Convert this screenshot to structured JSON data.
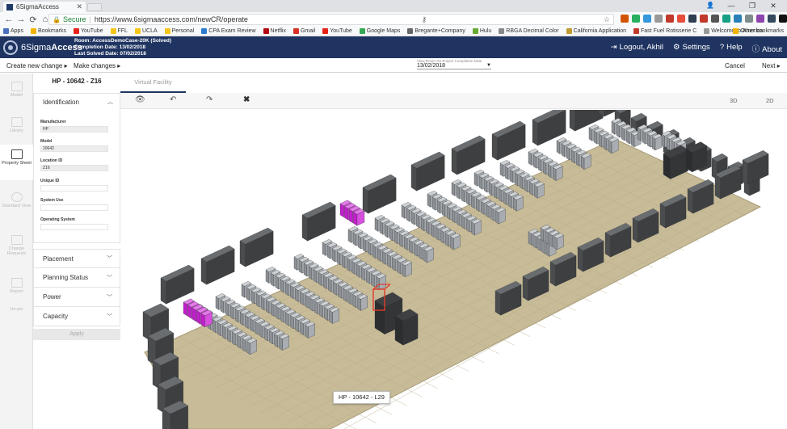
{
  "browser": {
    "tab_title": "6SigmaAccess",
    "secure_label": "Secure",
    "url": "https://www.6sigmaaccess.com/newCR/operate",
    "bookmarks": [
      {
        "label": "Apps",
        "color": "#4a6fbf"
      },
      {
        "label": "Bookmarks",
        "color": "#f2b400"
      },
      {
        "label": "YouTube",
        "color": "#e62117"
      },
      {
        "label": "FFL",
        "color": "#f5c518"
      },
      {
        "label": "UCLA",
        "color": "#f5c518"
      },
      {
        "label": "Personal",
        "color": "#f5c518"
      },
      {
        "label": "CPA Exam Review",
        "color": "#2c7bd1"
      },
      {
        "label": "Netflix",
        "color": "#b20710"
      },
      {
        "label": "Gmail",
        "color": "#d93025"
      },
      {
        "label": "YouTube",
        "color": "#e62117"
      },
      {
        "label": "Google Maps",
        "color": "#34a853"
      },
      {
        "label": "Bregante+Company",
        "color": "#666666"
      },
      {
        "label": "Hulu",
        "color": "#66aa33"
      },
      {
        "label": "RBGA Decimal Color",
        "color": "#888888"
      },
      {
        "label": "California Application",
        "color": "#c19a30"
      },
      {
        "label": "Fast Fuel Rotisserie C",
        "color": "#c0392b"
      },
      {
        "label": "Welcome to America",
        "color": "#999999"
      }
    ],
    "other_bookmarks": "Other bookmarks",
    "extension_colors": [
      "#d35400",
      "#27ae60",
      "#3498db",
      "#999999",
      "#c0392b",
      "#e74c3c",
      "#2c3e50",
      "#c0392b",
      "#555555",
      "#16a085",
      "#2980b9",
      "#7f8c8d",
      "#8e44ad",
      "#34495e",
      "#111111",
      "#c0392b",
      "#95a5a6"
    ]
  },
  "app": {
    "logo_bold": "6Sigma",
    "logo_rest": "Access",
    "room_line": "Room: AccessDemoCase-20K (Solved)",
    "completion_line": "Completion Date: 13/02/2018",
    "solved_line": "Last Solved Date: 07/02/2018",
    "logout": "Logout, Akhil",
    "settings": "Settings",
    "help": "Help",
    "about": "About"
  },
  "subheader": {
    "create": "Create new change",
    "make": "Make changes",
    "date_label": "View Room On Project Completion Date",
    "date_value": "13/02/2018",
    "cancel": "Cancel",
    "next": "Next"
  },
  "rail": {
    "items": [
      "Model",
      "Library",
      "Property Sheet",
      "Standard View",
      "Change Requests",
      "Report",
      "Un-pin"
    ]
  },
  "panel": {
    "title": "HP - 10642 - Z16",
    "identification": "Identification",
    "fields": [
      {
        "label": "Manufacturer",
        "value": "HP"
      },
      {
        "label": "Model",
        "value": "10642"
      },
      {
        "label": "Location ID",
        "value": "Z16"
      },
      {
        "label": "Unique ID",
        "value": ""
      },
      {
        "label": "System Use",
        "value": ""
      },
      {
        "label": "Operating System",
        "value": ""
      }
    ],
    "sections": [
      "Placement",
      "Planning Status",
      "Power",
      "Capacity"
    ],
    "apply": "Apply"
  },
  "main": {
    "tab": "Virtual Facility",
    "view_3d": "3D",
    "view_2d": "2D",
    "tooltip": "HP - 10642 - L29",
    "colors": {
      "floor": "#c7bb98",
      "rack_dark": "#4f5153",
      "rack_light": "#9fa3a8",
      "highlight_magenta": "#c21fcc",
      "highlight_red": "#e03a2a"
    }
  }
}
